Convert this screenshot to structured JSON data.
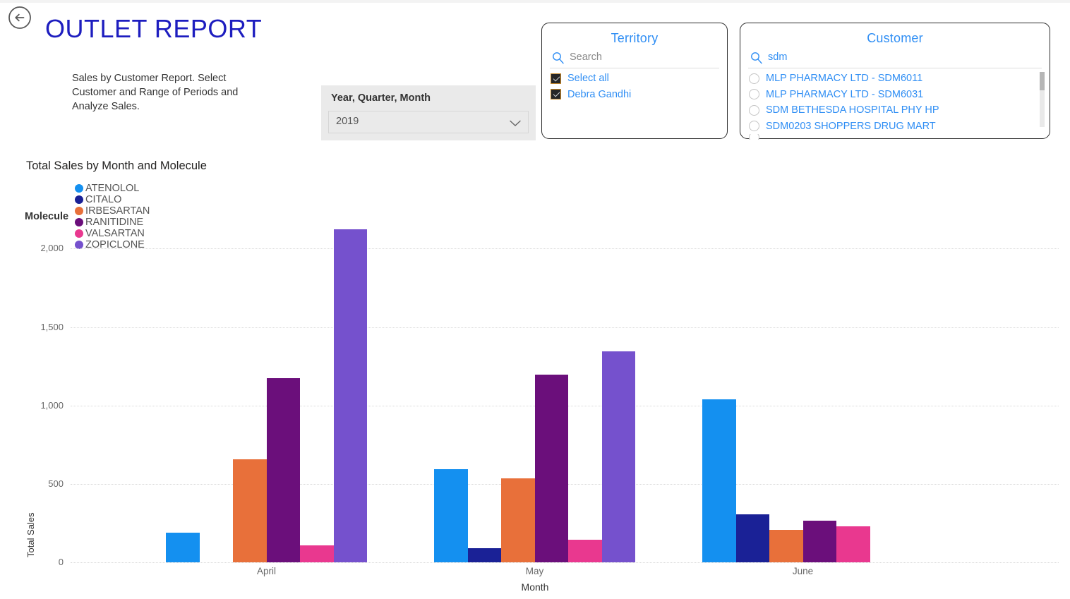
{
  "header": {
    "back_icon": "back-arrow-circle-icon",
    "title": "OUTLET REPORT",
    "description": "Sales by Customer Report. Select Customer and Range of Periods and Analyze Sales."
  },
  "year_slicer": {
    "label": "Year, Quarter, Month",
    "selected": "2019",
    "chevron_icon": "chevron-down-icon"
  },
  "territory_slicer": {
    "title": "Territory",
    "search_icon": "search-icon",
    "search_placeholder": "Search",
    "search_value": "",
    "items": [
      {
        "label": "Select all",
        "checked": true
      },
      {
        "label": "Debra Gandhi",
        "checked": true
      }
    ]
  },
  "customer_slicer": {
    "title": "Customer",
    "search_icon": "search-icon",
    "search_placeholder": "Search",
    "search_value": "sdm",
    "items": [
      {
        "label": "MLP PHARMACY LTD - SDM6011",
        "selected": false
      },
      {
        "label": "MLP PHARMACY LTD - SDM6031",
        "selected": false
      },
      {
        "label": "SDM BETHESDA HOSPITAL PHY HP",
        "selected": false
      },
      {
        "label": "SDM0203 SHOPPERS DRUG MART",
        "selected": false
      }
    ],
    "scrollbar": "vertical-scrollbar"
  },
  "chart_data": {
    "type": "bar",
    "title": "Total Sales by Month and Molecule",
    "legend_title": "Molecule",
    "legend_position": "top",
    "grid": true,
    "xlabel": "Month",
    "ylabel": "Total Sales",
    "categories": [
      "April",
      "May",
      "June"
    ],
    "ylim": [
      0,
      2200
    ],
    "yticks": [
      0,
      500,
      1000,
      1500,
      2000
    ],
    "ytick_labels": [
      "0",
      "500",
      "1,000",
      "1,500",
      "2,000"
    ],
    "series": [
      {
        "name": "ATENOLOL",
        "color": "#1490f0",
        "values": [
          188,
          594,
          1039
        ]
      },
      {
        "name": "CITALO",
        "color": "#1a2196",
        "values": [
          0,
          92,
          306
        ]
      },
      {
        "name": "IRBESARTAN",
        "color": "#e8703a",
        "values": [
          659,
          537,
          205
        ]
      },
      {
        "name": "RANITIDINE",
        "color": "#6b0f7b",
        "values": [
          1175,
          1196,
          266
        ]
      },
      {
        "name": "VALSARTAN",
        "color": "#e9388f",
        "values": [
          109,
          144,
          231
        ]
      },
      {
        "name": "ZOPICLONE",
        "color": "#7551cd",
        "values": [
          2122,
          1345,
          0
        ]
      }
    ]
  }
}
